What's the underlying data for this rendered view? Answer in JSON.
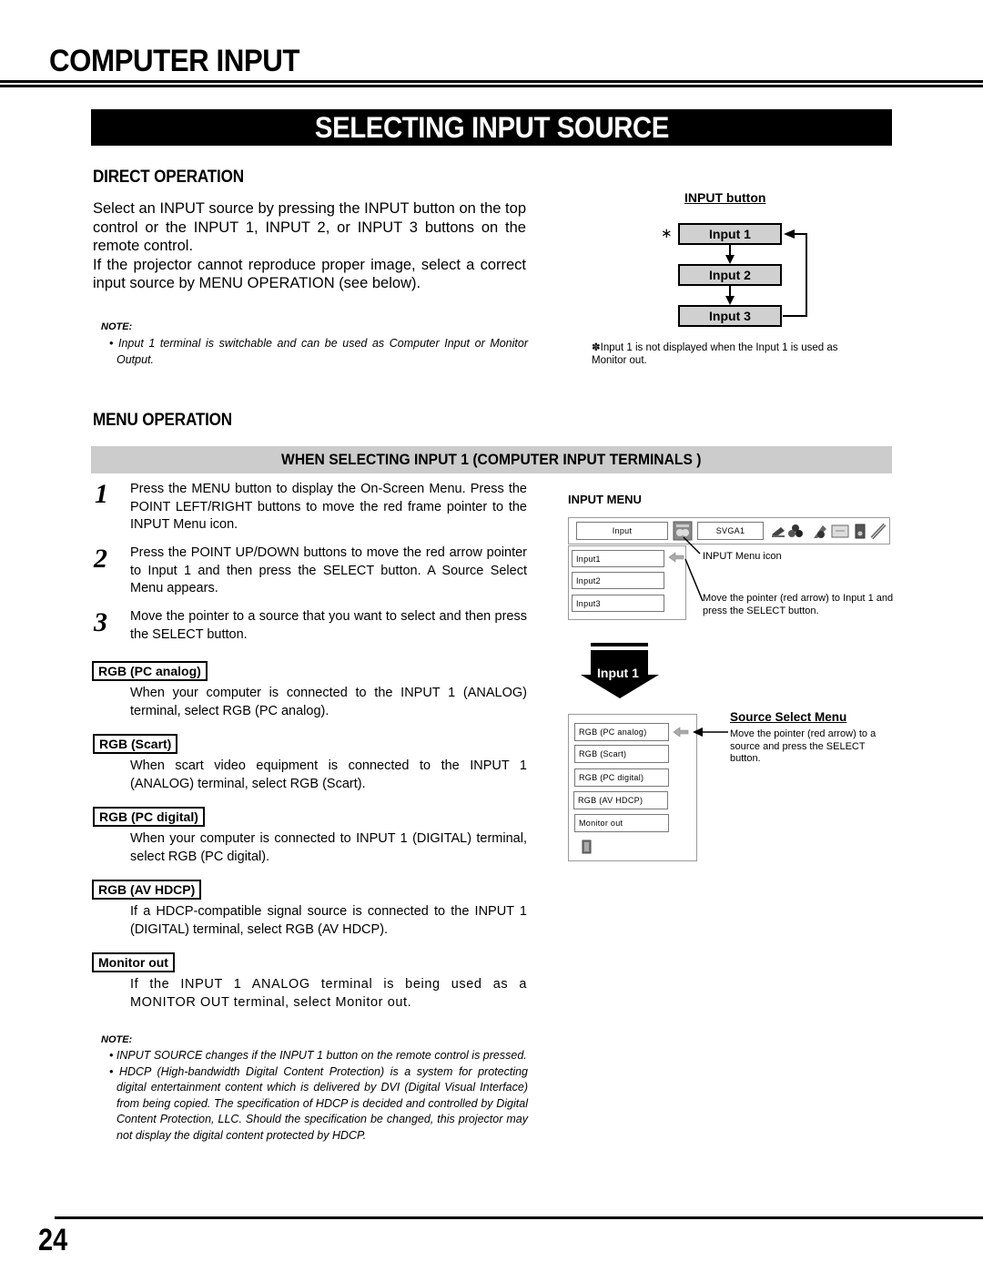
{
  "header": {
    "page_title": "COMPUTER INPUT",
    "section_title": "SELECTING INPUT SOURCE"
  },
  "direct_operation": {
    "heading": "DIRECT OPERATION",
    "paragraph1": "Select an INPUT source by pressing the INPUT button on the top control or the INPUT 1, INPUT 2, or INPUT 3 buttons on the remote control.",
    "paragraph2": "If the projector cannot reproduce proper image, select a correct input source by MENU OPERATION (see below).",
    "note_label": "NOTE:",
    "note_items": [
      "Input 1 terminal is switchable and can be used as Computer Input or Monitor Output."
    ],
    "diagram": {
      "title": "INPUT button",
      "asterisk": "∗",
      "boxes": [
        "Input 1",
        "Input 2",
        "Input 3"
      ],
      "footnote": "✽Input 1 is not displayed when the Input 1 is used as Monitor out."
    }
  },
  "menu_operation": {
    "heading": "MENU OPERATION",
    "sub_banner": "WHEN SELECTING INPUT 1 (COMPUTER INPUT TERMINALS )",
    "steps": [
      {
        "num": "1",
        "text": "Press the MENU button to display the On-Screen Menu. Press the POINT LEFT/RIGHT buttons to move the red frame pointer to the INPUT Menu icon."
      },
      {
        "num": "2",
        "text": "Press the POINT UP/DOWN buttons to move the red arrow pointer to Input 1 and then press the SELECT button. A Source Select Menu appears."
      },
      {
        "num": "3",
        "text": "Move the pointer to a source that you want to select and then press the SELECT button."
      }
    ],
    "options": [
      {
        "label": "RGB (PC analog)",
        "desc": "When your computer is connected to the INPUT 1 (ANALOG) terminal, select RGB (PC analog)."
      },
      {
        "label": "RGB (Scart)",
        "desc": "When scart video equipment is connected to the INPUT 1 (ANALOG) terminal, select RGB (Scart)."
      },
      {
        "label": "RGB (PC digital)",
        "desc": "When your computer is connected to INPUT 1 (DIGITAL) terminal, select RGB (PC digital)."
      },
      {
        "label": "RGB (AV HDCP)",
        "desc": "If a HDCP-compatible signal source is connected to the INPUT 1 (DIGITAL) terminal, select RGB (AV HDCP)."
      },
      {
        "label": "Monitor out",
        "desc": "If the INPUT 1 ANALOG terminal is being used as a MONITOR OUT terminal, select Monitor out."
      }
    ],
    "note_label": "NOTE:",
    "note_items": [
      "INPUT SOURCE changes if the INPUT 1 button on the remote control is pressed.",
      "HDCP (High-bandwidth Digital Content Protection) is a system for protecting digital entertainment content which is delivered by DVI (Digital Visual Interface) from being copied. The specification of HDCP is decided and controlled by Digital Content Protection, LLC. Should the specification be changed, this projector may not display the digital content protected by HDCP."
    ],
    "input_menu": {
      "label": "INPUT MENU",
      "menu_bar_title": "Input",
      "signal": "SVGA1",
      "icons": [
        "input-menu-icon",
        "laptop-icon",
        "color-icon",
        "image-adjust-icon",
        "screen-icon",
        "sound-icon",
        "setting-icon"
      ],
      "items": [
        "Input1",
        "Input2",
        "Input3"
      ],
      "callout_icon": "INPUT Menu icon",
      "callout_pointer": "Move the pointer (red arrow) to Input 1 and press the SELECT button."
    },
    "transition_arrow_label": "Input 1",
    "source_select_menu": {
      "title": "Source Select Menu",
      "items": [
        "RGB (PC analog)",
        "RGB (Scart)",
        "RGB (PC digital)",
        "RGB (AV HDCP)",
        "Monitor out"
      ],
      "callout": "Move the pointer (red arrow) to a source and press the SELECT button."
    }
  },
  "footer": {
    "page_number": "24"
  }
}
